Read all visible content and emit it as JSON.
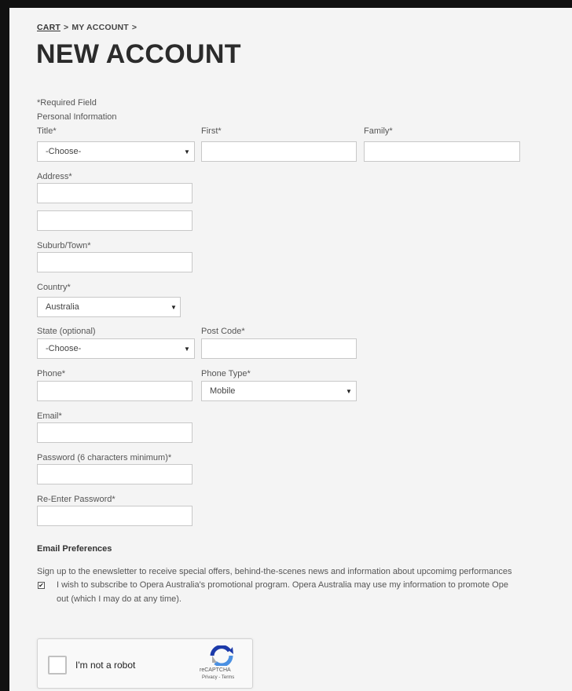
{
  "breadcrumb": {
    "items": [
      "CART",
      "MY ACCOUNT"
    ],
    "separator": ">"
  },
  "page_title": "NEW ACCOUNT",
  "form": {
    "required_note": "*Required Field",
    "section_personal": "Personal Information",
    "title_label": "Title*",
    "title_value": "-Choose-",
    "first_label": "First*",
    "family_label": "Family*",
    "address_label": "Address*",
    "suburb_label": "Suburb/Town*",
    "country_label": "Country*",
    "country_value": "Australia",
    "state_label": "State (optional)",
    "state_value": "-Choose-",
    "postcode_label": "Post Code*",
    "phone_label": "Phone*",
    "phone_type_label": "Phone Type*",
    "phone_type_value": "Mobile",
    "email_label": "Email*",
    "password_label": "Password (6 characters minimum)*",
    "reenter_password_label": "Re-Enter Password*"
  },
  "email_preferences": {
    "heading": "Email Preferences",
    "description": "Sign up to the enewsletter to receive special offers, behind-the-scenes news and information about upcomimg performances",
    "subscribe_checked": true,
    "subscribe_text_line1": "I wish to subscribe to Opera Australia's promotional program. Opera Australia may use my information to promote Ope",
    "subscribe_text_line2": "out (which I may do at any time)."
  },
  "captcha": {
    "label": "I'm not a robot",
    "brand": "reCAPTCHA",
    "links": "Privacy - Terms"
  },
  "icons": {
    "dropdown": "triangle-down",
    "check": "checkmark",
    "recaptcha": "recaptcha-logo"
  },
  "colors": {
    "page_bg": "#f4f4f4",
    "outer_bg": "#111111",
    "text": "#555555",
    "title": "#2b2b2b"
  }
}
